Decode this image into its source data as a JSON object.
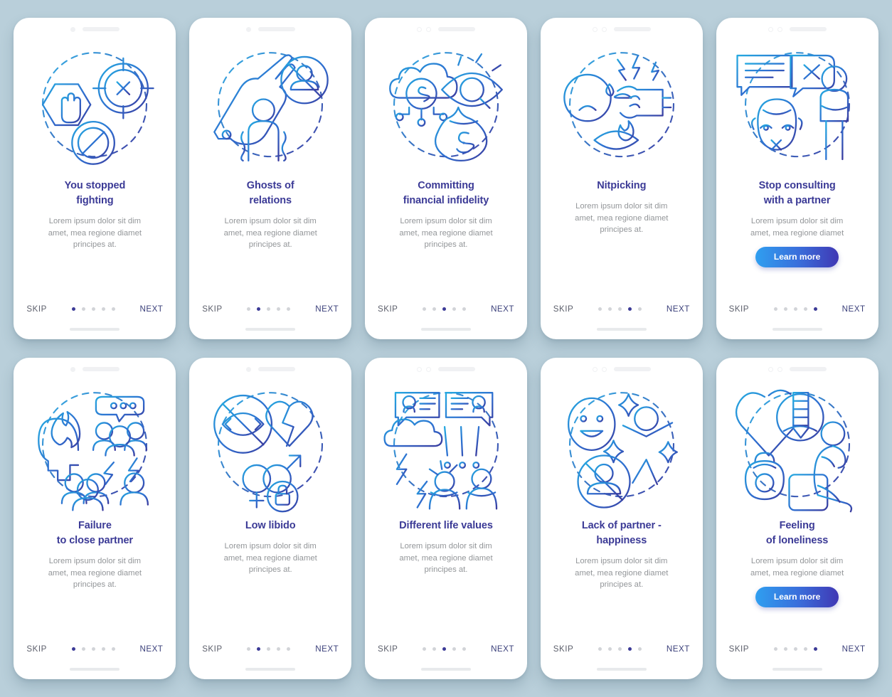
{
  "theme": {
    "background": "#b9cfda",
    "card_bg": "#ffffff",
    "title_color": "#3b3a96",
    "desc_color": "#939699",
    "dot_active": "#3b3a96",
    "dot_inactive": "#d2d4d8",
    "button_gradient_from": "#2f9ff0",
    "button_gradient_to": "#4038b4",
    "icon_gradient_from": "#29a8e0",
    "icon_gradient_to": "#3b3c9e"
  },
  "common": {
    "skip_label": "SKIP",
    "next_label": "NEXT",
    "learn_more_label": "Learn more",
    "description": "Lorem ipsum dolor sit dim\namet, mea regione diamet\nprincipes at.",
    "description_short": "Lorem ipsum dolor sit dim\namet, mea regione diamet",
    "dot_count": 5
  },
  "screens": [
    {
      "id": "you-stopped-fighting",
      "title": "You stopped\nfighting",
      "description": "Lorem ipsum dolor sit dim\namet, mea regione diamet\nprincipes at.",
      "active_dot": 0,
      "has_learn_more": false,
      "status_dots": 1,
      "icon_name": "stop-hand-target-prohibition-icon"
    },
    {
      "id": "ghosts-of-relations",
      "title": "Ghosts of\nrelations",
      "description": "Lorem ipsum dolor sit dim\namet, mea regione diamet\nprincipes at.",
      "active_dot": 1,
      "has_learn_more": false,
      "status_dots": 1,
      "icon_name": "ghost-hand-no-person-icon"
    },
    {
      "id": "committing-financial-infidelity",
      "title": "Committing\nfinancial infidelity",
      "description": "Lorem ipsum dolor sit dim\namet, mea regione diamet\nprincipes at.",
      "active_dot": 2,
      "has_learn_more": false,
      "status_dots": 2,
      "icon_name": "money-cloud-eye-moneybag-icon"
    },
    {
      "id": "nitpicking",
      "title": "Nitpicking",
      "description": "Lorem ipsum dolor sit dim\namet, mea regione diamet\nprincipes at.",
      "active_dot": 3,
      "has_learn_more": false,
      "status_dots": 2,
      "icon_name": "sad-face-pointing-finger-fire-eye-icon"
    },
    {
      "id": "stop-consulting-with-a-partner",
      "title": "Stop consulting\nwith a partner",
      "description": "Lorem ipsum dolor sit dim\namet, mea regione diamet",
      "active_dot": 4,
      "has_learn_more": true,
      "status_dots": 2,
      "icon_name": "speech-bubble-silent-woman-man-icon"
    },
    {
      "id": "failure-to-close-partner",
      "title": "Failure\nto close partner",
      "description": "Lorem ipsum dolor sit dim\namet, mea regione diamet\nprincipes at.",
      "active_dot": 0,
      "has_learn_more": false,
      "status_dots": 1,
      "icon_name": "angry-head-crowd-lightning-icon"
    },
    {
      "id": "low-libido",
      "title": "Low libido",
      "description": "Lorem ipsum dolor sit dim\namet, mea regione diamet\nprincipes at.",
      "active_dot": 1,
      "has_learn_more": false,
      "status_dots": 1,
      "icon_name": "no-kiss-broken-heart-gender-lock-icon"
    },
    {
      "id": "different-life-values",
      "title": "Different life values",
      "description": "Lorem ipsum dolor sit dim\namet, mea regione diamet\nprincipes at.",
      "active_dot": 2,
      "has_learn_more": false,
      "status_dots": 2,
      "icon_name": "chat-bubbles-storm-argument-icon"
    },
    {
      "id": "lack-of-partner-happiness",
      "title": "Lack of partner -\nhappiness",
      "description": "Lorem ipsum dolor sit dim\namet, mea regione diamet\nprincipes at.",
      "active_dot": 3,
      "has_learn_more": false,
      "status_dots": 2,
      "icon_name": "smiley-jumping-person-no-partner-icon"
    },
    {
      "id": "feeling-of-loneliness",
      "title": "Feeling\nof loneliness",
      "description": "Lorem ipsum dolor sit dim\namet, mea regione diamet",
      "active_dot": 4,
      "has_learn_more": true,
      "status_dots": 2,
      "icon_name": "heart-screw-weight-sitting-person-icon"
    }
  ]
}
